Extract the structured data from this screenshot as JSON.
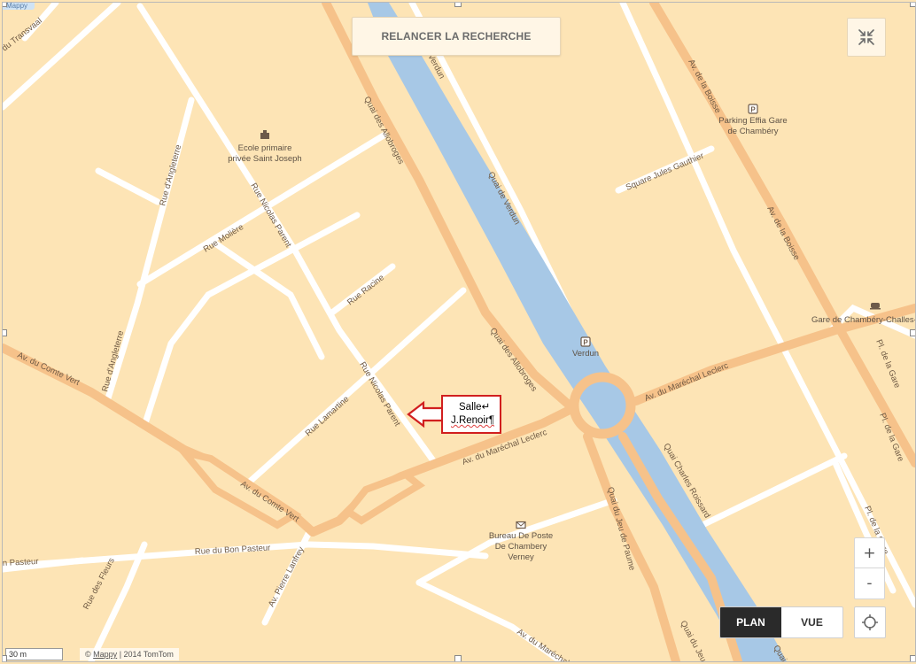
{
  "controls": {
    "search_again": "RELANCER LA RECHERCHE",
    "mode_plan": "PLAN",
    "mode_vue": "VUE",
    "zoom_in": "+",
    "zoom_out": "-"
  },
  "footer": {
    "scale": "30 m",
    "copyright_prefix": "©",
    "copyright_brand": "Mappy",
    "copyright_suffix": "| 2014 TomTom",
    "logo": "Mappy"
  },
  "callout": {
    "line1": "Salle↵",
    "line2": "J.Renoir¶"
  },
  "streets": {
    "transvaal": "du Transvaal",
    "verdun_top": "Verdun",
    "allobroges_top": "Quai des Allobroges",
    "quai_verdun": "Quai de Verdun",
    "boisse_top": "Av. de la Boisse",
    "boisse_mid": "Av. de la Boisse",
    "angleterre_top": "Rue d'Angleterre",
    "angleterre_bottom": "Rue d'Angleterre",
    "nicolas_parent_top": "Rue Nicolas Parent",
    "nicolas_parent_bottom": "Rue Nicolas Parent",
    "moliere": "Rue Molière",
    "racine": "Rue Racine",
    "jules_gauthier": "Square Jules Gauthier",
    "allobroges_bottom": "Quai des Allobroges",
    "comte_vert_left": "Av. du Comte Vert",
    "comte_vert_right": "Av. du Comte Vert",
    "lamartine": "Rue Lamartine",
    "marechal_leclerc_left": "Av. du Maréchal Leclerc",
    "marechal_leclerc_right": "Av. du Maréchal Leclerc",
    "charles_roissard": "Quai Charles Roissard",
    "jeu_paume_left": "Quai du Jeu de Paume",
    "jeu_paume_right": "Quai du Jeu",
    "pl_gare_top": "Pl. de la Gare",
    "pl_gare_mid": "Pl. de la Gare",
    "pl_gare_bottom": "Pl. de la Gare",
    "bon_pasteur": "Rue du Bon Pasteur",
    "pasteur_left": "n Pasteur",
    "fleurs": "Rue des Fleurs",
    "pierre_lanfrey": "Av. Pierre Lanfrey",
    "marechal_bottom": "Av. du Maréchal Le",
    "quai_edge": "Quai"
  },
  "pois": {
    "school_line1": "Ecole primaire",
    "school_line2": "privée Saint Joseph",
    "parking_line1": "Parking Effia Gare",
    "parking_line2": "de Chambéry",
    "verdun_parking": "Verdun",
    "station": "Gare de Chambéry-Challes-les",
    "post_line1": "Bureau De Poste",
    "post_line2": "De Chambery",
    "post_line3": "Verney",
    "parking_symbol": "P"
  },
  "colors": {
    "land": "#fde4b5",
    "major_road": "#f6c28a",
    "minor_road": "#ffffff",
    "river": "#a7c8e6",
    "callout_border": "#d11f1f"
  }
}
